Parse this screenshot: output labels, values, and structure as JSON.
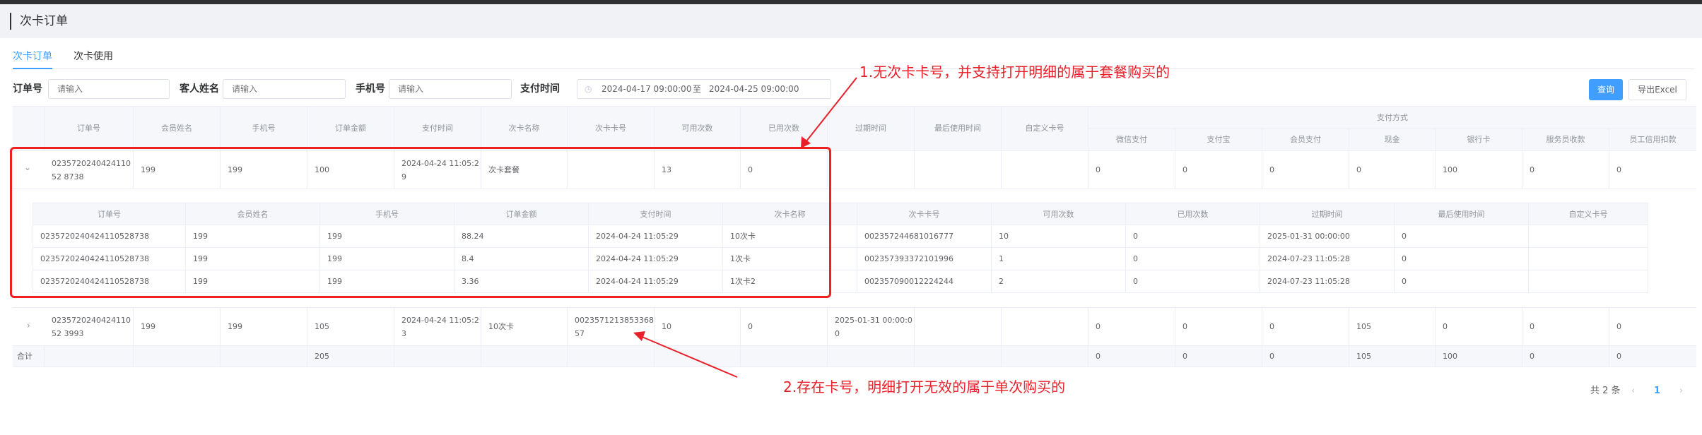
{
  "page": {
    "title": "次卡订单"
  },
  "tabs": [
    {
      "label": "次卡订单",
      "active": true
    },
    {
      "label": "次卡使用",
      "active": false
    }
  ],
  "filters": {
    "order_label": "订单号",
    "order_placeholder": "请输入",
    "name_label": "客人姓名",
    "name_placeholder": "请输入",
    "phone_label": "手机号",
    "phone_placeholder": "请输入",
    "paytime_label": "支付时间",
    "date_start": "2024-04-17 09:00:00",
    "date_sep": "至",
    "date_end": "2024-04-25 09:00:00"
  },
  "buttons": {
    "search": "查询",
    "export": "导出Excel"
  },
  "table": {
    "headers": [
      "订单号",
      "会员姓名",
      "手机号",
      "订单金额",
      "支付时间",
      "次卡名称",
      "次卡卡号",
      "可用次数",
      "已用次数",
      "过期时间",
      "最后使用时间",
      "自定义卡号"
    ],
    "pay_group": "支付方式",
    "pay_headers": [
      "微信支付",
      "支付宝",
      "会员支付",
      "现金",
      "银行卡",
      "服务员收款",
      "员工信用扣款"
    ],
    "rows": [
      {
        "expanded": true,
        "cells": [
          "023572024042411052 8738",
          "199",
          "199",
          "100",
          "2024-04-24 11:05:29",
          "次卡套餐",
          "",
          "13",
          "0",
          "",
          "",
          "",
          "0",
          "0",
          "0",
          "0",
          "100",
          "0",
          "0"
        ]
      },
      {
        "expanded": false,
        "cells": [
          "023572024042411052 3993",
          "199",
          "199",
          "105",
          "2024-04-24 11:05:23",
          "10次卡",
          "002357121385336857",
          "10",
          "0",
          "2025-01-31 00:00:00",
          "",
          "",
          "0",
          "0",
          "0",
          "105",
          "0",
          "0",
          "0"
        ]
      }
    ],
    "total": {
      "label": "合计",
      "cells": [
        "",
        "",
        "",
        "205",
        "",
        "",
        "",
        "",
        "",
        "",
        "",
        "",
        "0",
        "0",
        "0",
        "105",
        "100",
        "0",
        "0"
      ]
    }
  },
  "detail": {
    "headers": [
      "订单号",
      "会员姓名",
      "手机号",
      "订单金额",
      "支付时间",
      "次卡名称",
      "次卡卡号",
      "可用次数",
      "已用次数",
      "过期时间",
      "最后使用时间",
      "自定义卡号"
    ],
    "rows": [
      [
        "0235720240424110528738",
        "199",
        "199",
        "88.24",
        "2024-04-24 11:05:29",
        "10次卡",
        "002357244681016777",
        "10",
        "0",
        "2025-01-31 00:00:00",
        "0",
        ""
      ],
      [
        "0235720240424110528738",
        "199",
        "199",
        "8.4",
        "2024-04-24 11:05:29",
        "1次卡",
        "002357393372101996",
        "1",
        "0",
        "2024-07-23 11:05:28",
        "0",
        ""
      ],
      [
        "0235720240424110528738",
        "199",
        "199",
        "3.36",
        "2024-04-24 11:05:29",
        "1次卡2",
        "002357090012224244",
        "2",
        "0",
        "2024-07-23 11:05:28",
        "0",
        ""
      ]
    ]
  },
  "annotations": {
    "note1": "1.无次卡卡号，并支持打开明细的属于套餐购买的",
    "note2": "2.存在卡号，明细打开无效的属于单次购买的",
    "color": "#e8202a"
  },
  "pager": {
    "total": "共 2 条",
    "current": "1"
  }
}
